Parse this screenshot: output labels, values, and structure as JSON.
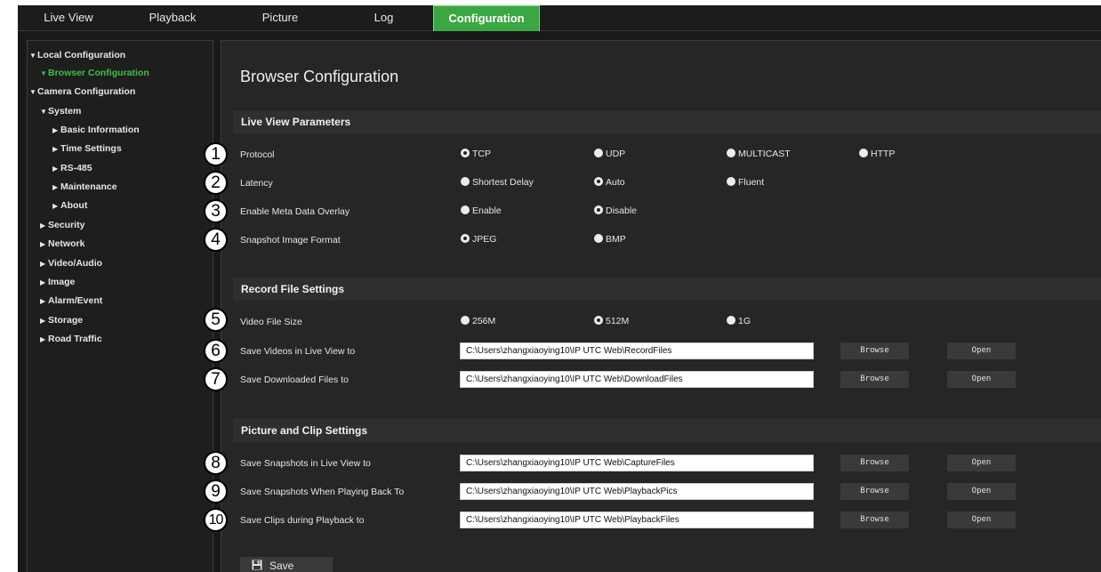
{
  "nav": {
    "tabs": [
      {
        "label": "Live View"
      },
      {
        "label": "Playback"
      },
      {
        "label": "Picture"
      },
      {
        "label": "Log"
      },
      {
        "label": "Configuration"
      }
    ],
    "active": "Configuration"
  },
  "sidebar": {
    "local_config": "Local Configuration",
    "browser_config": "Browser Configuration",
    "camera_config": "Camera Configuration",
    "system": "System",
    "basic_info": "Basic Information",
    "time_settings": "Time Settings",
    "rs485": "RS-485",
    "maintenance": "Maintenance",
    "about": "About",
    "security": "Security",
    "network": "Network",
    "video_audio": "Video/Audio",
    "image": "Image",
    "alarm_event": "Alarm/Event",
    "storage": "Storage",
    "road_traffic": "Road Traffic"
  },
  "page": {
    "title": "Browser Configuration"
  },
  "sections": {
    "live_view": "Live View Parameters",
    "record": "Record File Settings",
    "picture_clip": "Picture and Clip Settings"
  },
  "fields": {
    "protocol": {
      "label": "Protocol",
      "options": [
        "TCP",
        "UDP",
        "MULTICAST",
        "HTTP"
      ],
      "selected": "TCP"
    },
    "latency": {
      "label": "Latency",
      "options": [
        "Shortest Delay",
        "Auto",
        "Fluent"
      ],
      "selected": "Auto"
    },
    "meta_overlay": {
      "label": "Enable Meta Data Overlay",
      "options": [
        "Enable",
        "Disable"
      ],
      "selected": "Disable"
    },
    "snapshot_format": {
      "label": "Snapshot Image Format",
      "options": [
        "JPEG",
        "BMP"
      ],
      "selected": "JPEG"
    },
    "video_file_size": {
      "label": "Video File Size",
      "options": [
        "256M",
        "512M",
        "1G"
      ],
      "selected": "512M"
    },
    "save_live_videos": {
      "label": "Save Videos in Live View to",
      "value": "C:\\Users\\zhangxiaoying10\\IP UTC Web\\RecordFiles"
    },
    "save_downloaded": {
      "label": "Save Downloaded Files to",
      "value": "C:\\Users\\zhangxiaoying10\\IP UTC Web\\DownloadFiles"
    },
    "save_snapshots_live": {
      "label": "Save Snapshots in Live View to",
      "value": "C:\\Users\\zhangxiaoying10\\IP UTC Web\\CaptureFiles"
    },
    "save_snapshots_playback": {
      "label": "Save Snapshots When Playing Back To",
      "value": "C:\\Users\\zhangxiaoying10\\IP UTC Web\\PlaybackPics"
    },
    "save_clips_playback": {
      "label": "Save Clips during Playback to",
      "value": "C:\\Users\\zhangxiaoying10\\IP UTC Web\\PlaybackFiles"
    }
  },
  "buttons": {
    "browse": "Browse",
    "open": "Open",
    "save": "Save"
  },
  "callouts": [
    "1",
    "2",
    "3",
    "4",
    "5",
    "6",
    "7",
    "8",
    "9",
    "10"
  ],
  "colors": {
    "accent": "#3aa742",
    "current_item": "#3fbf4a",
    "background": "#262626"
  }
}
